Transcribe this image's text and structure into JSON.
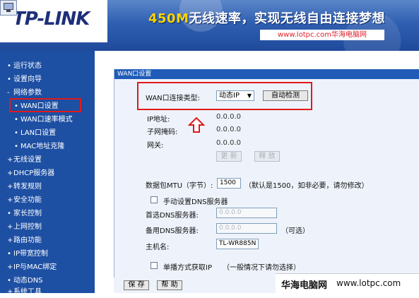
{
  "header": {
    "logo": "TP-LINK",
    "slogan_highlight": "450M",
    "slogan_rest": "无线速率，实现无线自由连接梦想",
    "site_url": "www.lotpc.com华海电脑网"
  },
  "sidebar": {
    "items": [
      {
        "label": "运行状态",
        "level": 0,
        "bullet": "•"
      },
      {
        "label": "设置向导",
        "level": 0,
        "bullet": "•"
      },
      {
        "label": "网络参数",
        "level": 0,
        "bullet": "-"
      },
      {
        "label": "WAN口设置",
        "level": 1,
        "bullet": "•",
        "selected": true
      },
      {
        "label": "WAN口速率模式",
        "level": 1,
        "bullet": "•"
      },
      {
        "label": "LAN口设置",
        "level": 1,
        "bullet": "•"
      },
      {
        "label": "MAC地址克隆",
        "level": 1,
        "bullet": "•"
      },
      {
        "label": "无线设置",
        "level": 0,
        "bullet": "+"
      },
      {
        "label": "DHCP服务器",
        "level": 0,
        "bullet": "+"
      },
      {
        "label": "转发规则",
        "level": 0,
        "bullet": "+"
      },
      {
        "label": "安全功能",
        "level": 0,
        "bullet": "+"
      },
      {
        "label": "家长控制",
        "level": 0,
        "bullet": "•"
      },
      {
        "label": "上网控制",
        "level": 0,
        "bullet": "+"
      },
      {
        "label": "路由功能",
        "level": 0,
        "bullet": "+"
      },
      {
        "label": "IP带宽控制",
        "level": 0,
        "bullet": "•"
      },
      {
        "label": "IP与MAC绑定",
        "level": 0,
        "bullet": "+"
      },
      {
        "label": "动态DNS",
        "level": 0,
        "bullet": "•"
      },
      {
        "label": "系统工具",
        "level": 0,
        "bullet": "+"
      }
    ]
  },
  "panel": {
    "title": "WAN口设置",
    "conn_type_label": "WAN口连接类型:",
    "conn_type_value": "动态IP",
    "auto_detect": "自动检测",
    "ip_label": "IP地址:",
    "ip_value": "0.0.0.0",
    "mask_label": "子网掩码:",
    "mask_value": "0.0.0.0",
    "gw_label": "网关:",
    "gw_value": "0.0.0.0",
    "renew": "更 新",
    "release": "释 放",
    "mtu_label": "数据包MTU（字节）:",
    "mtu_value": "1500",
    "mtu_hint": "（默认是1500，如非必要，请勿修改）",
    "manual_dns": "手动设置DNS服务器",
    "dns1_label": "首选DNS服务器:",
    "dns1_value": "0.0.0.0",
    "dns2_label": "备用DNS服务器:",
    "dns2_value": "0.0.0.0",
    "optional": "（可选）",
    "host_label": "主机名:",
    "host_value": "TL-WR885N",
    "unicast": "单播方式获取IP",
    "unicast_hint": "（一般情况下请勿选择）",
    "save": "保 存",
    "help": "帮 助"
  },
  "watermark": {
    "name": "华海电脑网",
    "url": "www.lotpc.com"
  },
  "colors": {
    "sidebar_bg": "#1d4fa3",
    "panel_title_bg": "#1f5bb7",
    "highlight_red": "#e01a1a",
    "slogan_yellow": "#ffd400"
  }
}
